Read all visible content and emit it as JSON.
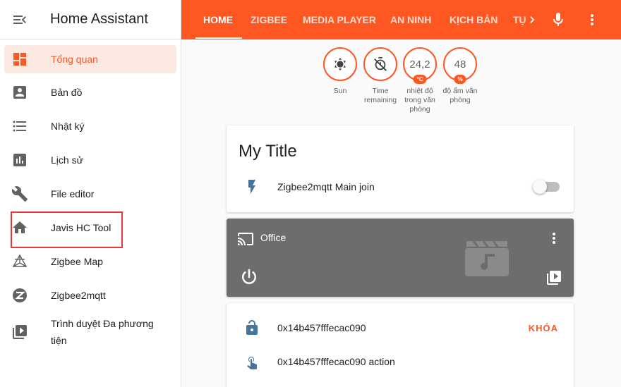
{
  "sidebar": {
    "title": "Home Assistant",
    "items": [
      {
        "label": "Tổng quan",
        "icon": "dashboard-icon",
        "active": true
      },
      {
        "label": "Bản đồ",
        "icon": "account-box-icon"
      },
      {
        "label": "Nhật ký",
        "icon": "list-icon"
      },
      {
        "label": "Lịch sử",
        "icon": "chart-bar-icon"
      },
      {
        "label": "File editor",
        "icon": "wrench-icon"
      },
      {
        "label": "Javis HC Tool",
        "icon": "home-icon"
      },
      {
        "label": "Zigbee Map",
        "icon": "graph-icon"
      },
      {
        "label": "Zigbee2mqtt",
        "icon": "zigbee-icon"
      },
      {
        "label": "Trình duyệt Đa phương tiện",
        "icon": "play-box-icon"
      }
    ]
  },
  "topbar": {
    "tabs": [
      "HOME",
      "ZIGBEE",
      "MEDIA PLAYER",
      "AN NINH",
      "KỊCH BẢN",
      "TỰ"
    ],
    "active_tab": "HOME",
    "accent_color": "#ff5722"
  },
  "badges": [
    {
      "value": "",
      "unit": "",
      "label": "Sun",
      "icon": "sun-icon"
    },
    {
      "value": "",
      "unit": "",
      "label": "Time remaining",
      "icon": "timer-off-icon"
    },
    {
      "value": "24,2",
      "unit": "°C",
      "label": "nhiệt độ trong văn phòng"
    },
    {
      "value": "48",
      "unit": "%",
      "label": "độ ẩm văn phòng"
    }
  ],
  "card1": {
    "title": "My Title",
    "entity": "Zigbee2mqtt Main join",
    "toggle_on": false
  },
  "media": {
    "name": "Office"
  },
  "card3": {
    "lock_entity": "0x14b457fffecac090",
    "lock_action": "KHÓA",
    "action_entity": "0x14b457fffecac090 action"
  }
}
